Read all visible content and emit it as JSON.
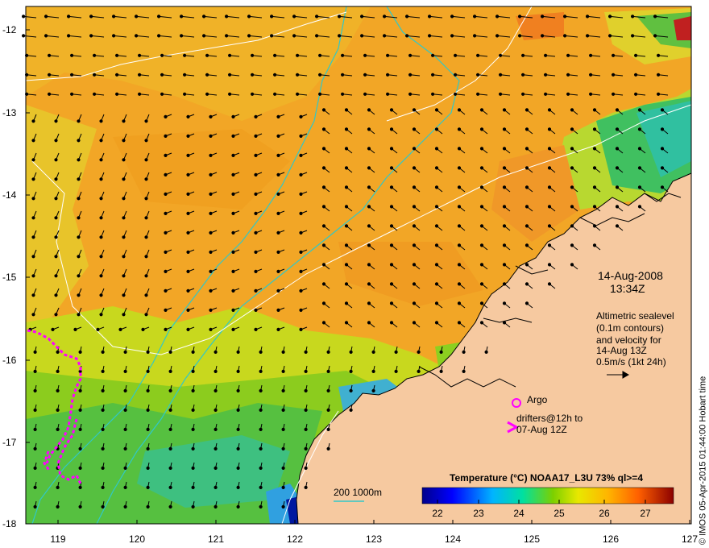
{
  "map": {
    "y_ticks": [
      "-12",
      "-13",
      "-14",
      "-15",
      "-16",
      "-17",
      "-18"
    ],
    "x_ticks": [
      "119",
      "120",
      "121",
      "122",
      "123",
      "124",
      "125",
      "126",
      "127"
    ],
    "lon_range": [
      118.6,
      127
    ],
    "lat_range": [
      -18,
      -11.8
    ]
  },
  "annotation": {
    "date": "14-Aug-2008",
    "time": "13:34Z",
    "altimetry_lines": [
      "Altimetric sealevel",
      "(0.1m contours)",
      "and velocity for",
      "14-Aug 13Z",
      "0.5m/s (1kt 24h)"
    ]
  },
  "legend": {
    "argo": "Argo",
    "drifters_line1": "drifters@12h to",
    "drifters_line2": "07-Aug 12Z",
    "depth_contours": "200  1000m",
    "argo_color": "#ff00ff",
    "drifter_color": "#ff00ff"
  },
  "colorbar": {
    "title": "Temperature (°C) NOAA17_L3U 73% ql>=4",
    "ticks": [
      "22",
      "23",
      "24",
      "25",
      "26",
      "27"
    ],
    "range": [
      21.6,
      27.8
    ]
  },
  "credit": "© IMOS 05-Apr-2015 01:44:00 Hobart time"
}
